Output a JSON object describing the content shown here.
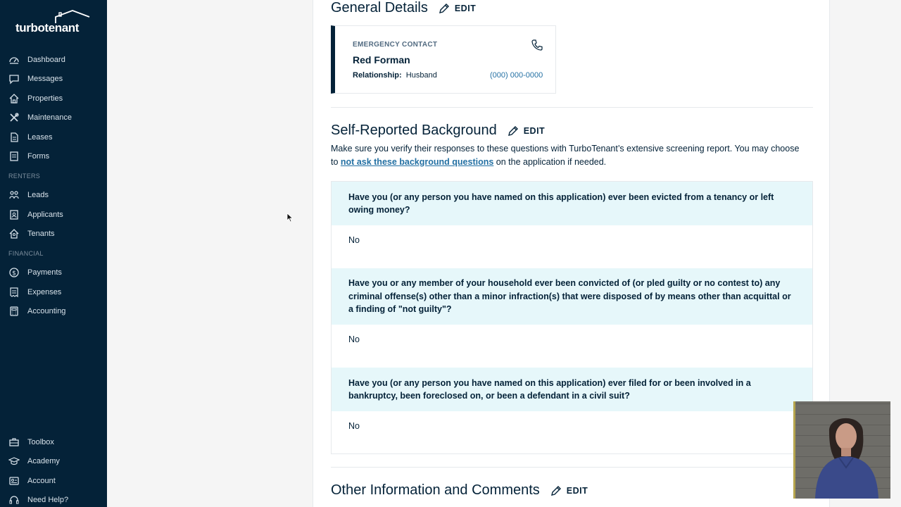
{
  "brand": {
    "name": "turbotenant"
  },
  "sidebar": {
    "items": [
      {
        "label": "Dashboard",
        "icon": "dashboard-icon"
      },
      {
        "label": "Messages",
        "icon": "messages-icon"
      },
      {
        "label": "Properties",
        "icon": "properties-icon"
      },
      {
        "label": "Maintenance",
        "icon": "maintenance-icon"
      },
      {
        "label": "Leases",
        "icon": "leases-icon"
      },
      {
        "label": "Forms",
        "icon": "forms-icon"
      }
    ],
    "renters_header": "RENTERS",
    "renters": [
      {
        "label": "Leads",
        "icon": "leads-icon"
      },
      {
        "label": "Applicants",
        "icon": "applicants-icon"
      },
      {
        "label": "Tenants",
        "icon": "tenants-icon"
      }
    ],
    "financial_header": "FINANCIAL",
    "financial": [
      {
        "label": "Payments",
        "icon": "payments-icon"
      },
      {
        "label": "Expenses",
        "icon": "expenses-icon"
      },
      {
        "label": "Accounting",
        "icon": "accounting-icon"
      }
    ],
    "bottom": [
      {
        "label": "Toolbox",
        "icon": "toolbox-icon"
      },
      {
        "label": "Academy",
        "icon": "academy-icon"
      },
      {
        "label": "Account",
        "icon": "account-icon"
      },
      {
        "label": "Need Help?",
        "icon": "help-icon"
      }
    ]
  },
  "general": {
    "title": "General Details",
    "edit": "EDIT",
    "contact": {
      "label": "EMERGENCY CONTACT",
      "name": "Red Forman",
      "relationship_label": "Relationship:",
      "relationship": "Husband",
      "phone": "(000) 000-0000"
    }
  },
  "background": {
    "title": "Self-Reported Background",
    "edit": "EDIT",
    "intro_before": "Make sure you verify their responses to these questions with TurboTenant’s extensive screening report. You may choose to ",
    "intro_link": "not ask these background questions",
    "intro_after": " on the application if needed.",
    "questions": [
      {
        "q": "Have you (or any person you have named on this application) ever been evicted from a tenancy or left owing money?",
        "a": "No"
      },
      {
        "q": "Have you or any member of your household ever been convicted of (or pled guilty or no contest to) any criminal offense(s) other than a minor infraction(s) that were disposed of by means other than acquittal or a finding of \"not guilty\"?",
        "a": "No"
      },
      {
        "q": "Have you (or any person you have named on this application) ever filed for or been involved in a bankruptcy, been foreclosed on, or been a defendant in a civil suit?",
        "a": "No"
      }
    ]
  },
  "other": {
    "title": "Other Information and Comments",
    "edit": "EDIT"
  },
  "colors": {
    "sidebar_bg": "#042238",
    "question_bg": "#e6f7fa",
    "link": "#2370a3"
  }
}
